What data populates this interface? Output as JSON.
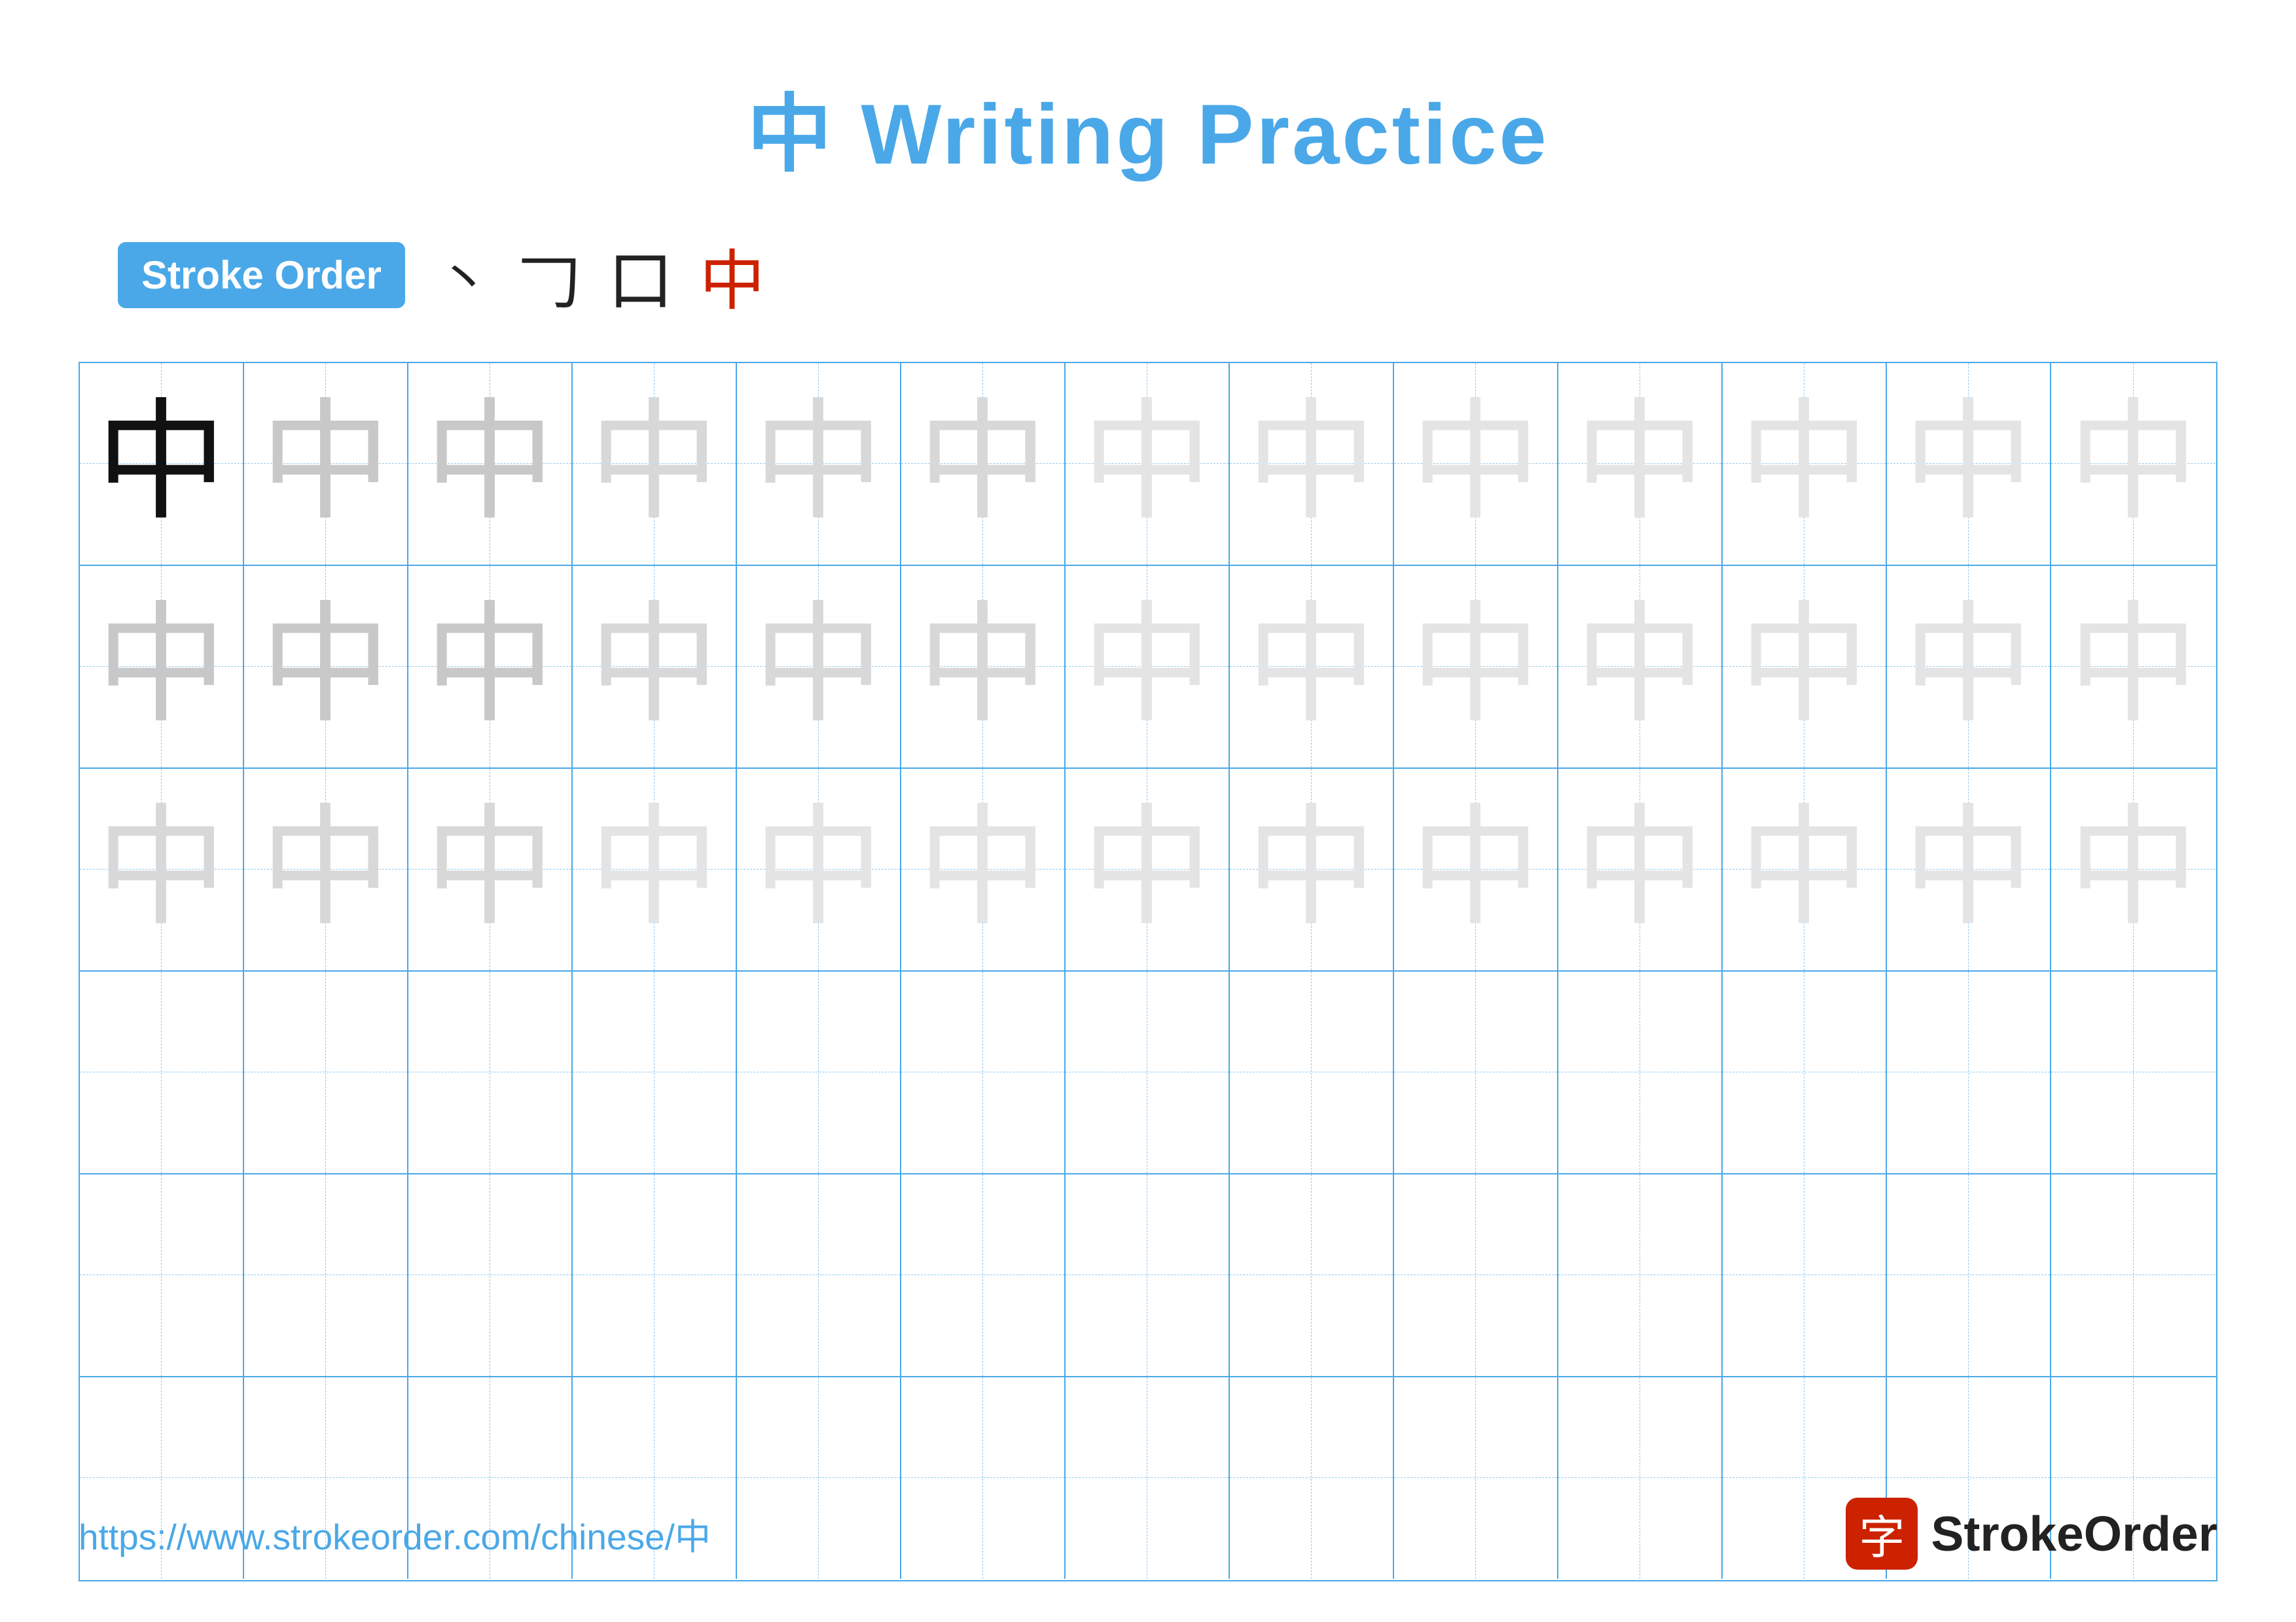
{
  "title": {
    "chinese": "中",
    "text": "Writing Practice",
    "full": "中 Writing Practice"
  },
  "stroke_order": {
    "badge_label": "Stroke Order",
    "strokes": [
      "丶",
      "𠃌",
      "口",
      "中"
    ],
    "colors": [
      "black",
      "black",
      "black",
      "red"
    ]
  },
  "grid": {
    "rows": 6,
    "cols": 13,
    "char": "中",
    "filled_rows": 3,
    "row_opacities": [
      "solid",
      "light1",
      "light2",
      "empty",
      "empty",
      "empty"
    ]
  },
  "footer": {
    "url": "https://www.strokeorder.com/chinese/中",
    "logo_char": "字",
    "logo_name": "StrokeOrder"
  }
}
